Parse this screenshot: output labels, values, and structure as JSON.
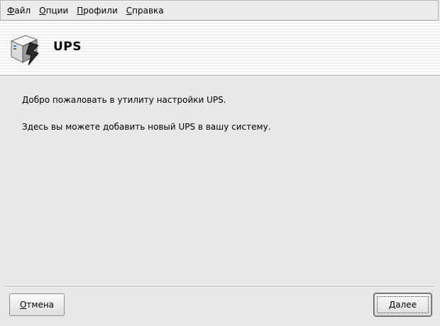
{
  "menu": {
    "items": [
      {
        "mnemonic": "Ф",
        "rest": "айл"
      },
      {
        "mnemonic": "О",
        "rest": "пции"
      },
      {
        "mnemonic": "П",
        "rest": "рофили"
      },
      {
        "mnemonic": "С",
        "rest": "правка"
      }
    ]
  },
  "header": {
    "title": "UPS",
    "icon": "ups-power-icon"
  },
  "content": {
    "welcome": "Добро пожаловать в утилиту настройки UPS.",
    "hint": "Здесь вы можете добавить новый UPS в вашу систему."
  },
  "buttons": {
    "cancel": {
      "mnemonic": "О",
      "rest": "тмена"
    },
    "next": {
      "mnemonic": "Д",
      "rest": "алее"
    }
  }
}
